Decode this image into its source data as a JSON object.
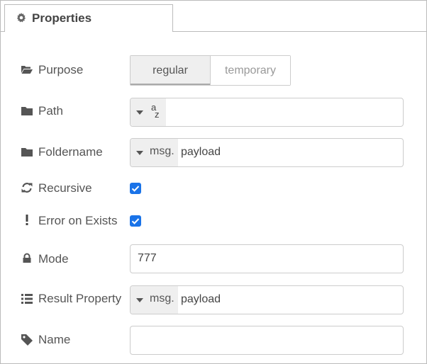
{
  "tab": {
    "label": "Properties",
    "icon": "gear-icon"
  },
  "purpose": {
    "label": "Purpose",
    "icon": "folder-open-icon",
    "options": [
      "regular",
      "temporary"
    ],
    "selected": "regular"
  },
  "path": {
    "label": "Path",
    "icon": "folder-icon",
    "type_glyph_top": "a",
    "type_glyph_bottom": "z",
    "value": ""
  },
  "foldername": {
    "label": "Foldername",
    "icon": "folder-icon",
    "type": "msg.",
    "value": "payload"
  },
  "recursive": {
    "label": "Recursive",
    "icon": "refresh-icon",
    "checked": true
  },
  "error_on_exists": {
    "label": "Error on Exists",
    "icon": "exclamation-icon",
    "checked": true
  },
  "mode": {
    "label": "Mode",
    "icon": "lock-icon",
    "value": "777"
  },
  "result_property": {
    "label": "Result Property",
    "icon": "list-icon",
    "type": "msg.",
    "value": "payload"
  },
  "name": {
    "label": "Name",
    "icon": "tag-icon",
    "value": ""
  },
  "colors": {
    "checkbox": "#1a73e8",
    "tab_border": "#bbbbbb",
    "type_bg": "#efefef"
  }
}
